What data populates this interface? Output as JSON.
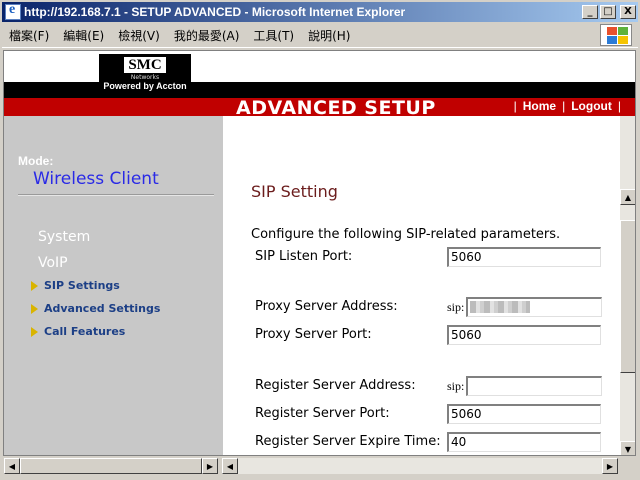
{
  "window": {
    "title": "http://192.168.7.1 - SETUP ADVANCED - Microsoft Internet Explorer",
    "minimize_label": "_",
    "maximize_label": "□",
    "close_label": "X"
  },
  "menubar": {
    "items": [
      {
        "label": "檔案(F)"
      },
      {
        "label": "編輯(E)"
      },
      {
        "label": "檢視(V)"
      },
      {
        "label": "我的最愛(A)"
      },
      {
        "label": "工具(T)"
      },
      {
        "label": "說明(H)"
      }
    ],
    "logo_colors": [
      "#e8512d",
      "#5fb23b",
      "#2b7bd6",
      "#f5c400"
    ]
  },
  "header": {
    "brand": "SMC",
    "brand_sub": "Networks",
    "powered_by": "Powered by Accton",
    "title": "ADVANCED SETUP",
    "links": [
      "Home",
      "Logout"
    ],
    "separator": "|"
  },
  "sidebar": {
    "mode_label": "Mode:",
    "mode_value": "Wireless Client",
    "sections": [
      "System",
      "VoIP"
    ],
    "items": [
      "SIP Settings",
      "Advanced Settings",
      "Call Features"
    ]
  },
  "content": {
    "section_title": "SIP Setting",
    "intro": "Configure the following SIP-related parameters.",
    "sip_prefix": "sip:",
    "fields": {
      "sip_listen_port": {
        "label": "SIP Listen Port:",
        "value": "5060"
      },
      "proxy_server_address": {
        "label": "Proxy Server Address:",
        "value": ""
      },
      "proxy_server_port": {
        "label": "Proxy Server Port:",
        "value": "5060"
      },
      "register_server_address": {
        "label": "Register Server Address:",
        "value": ""
      },
      "register_server_port": {
        "label": "Register Server Port:",
        "value": "5060"
      },
      "register_expire_time": {
        "label": "Register Server Expire Time:",
        "value": "40"
      }
    }
  },
  "colors": {
    "title_bar": "#0a246a",
    "header_red": "#c00000",
    "sidebar_bg": "#c8c8c8",
    "mode_value": "#2a2ae6",
    "section_title": "#6b1c1c",
    "nav_link": "#1c3f86",
    "nav_arrow": "#d9b400"
  },
  "scrollbars": {
    "up_arrow": "▲",
    "down_arrow": "▼",
    "left_arrow": "◀",
    "right_arrow": "▶"
  }
}
